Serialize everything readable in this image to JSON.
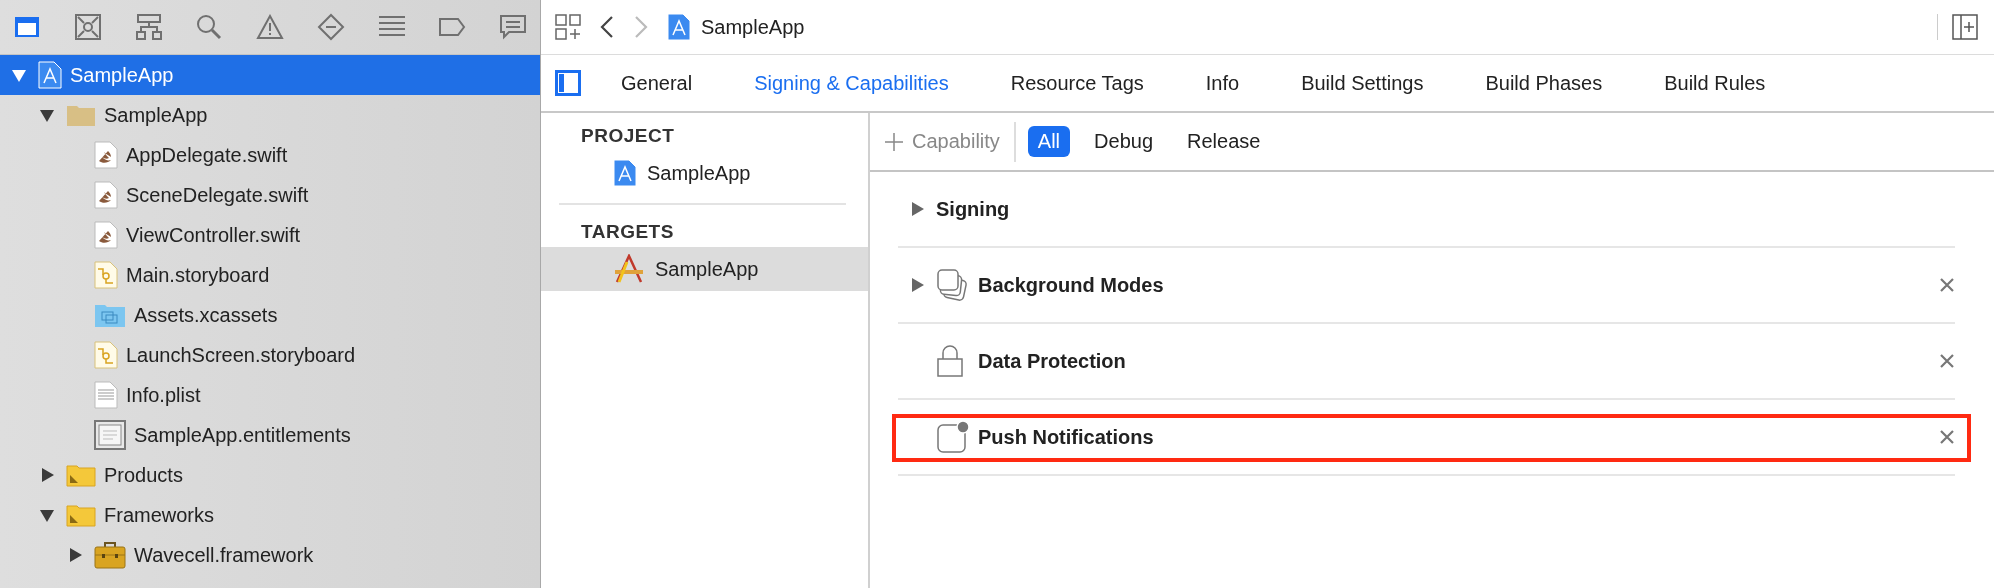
{
  "navigator_tabs": [
    {
      "kind": "folder",
      "selected": true
    },
    {
      "kind": "source-control",
      "selected": false
    },
    {
      "kind": "hierarchy",
      "selected": false
    },
    {
      "kind": "search",
      "selected": false
    },
    {
      "kind": "warning",
      "selected": false
    },
    {
      "kind": "test",
      "selected": false
    },
    {
      "kind": "list",
      "selected": false
    },
    {
      "kind": "tag",
      "selected": false
    },
    {
      "kind": "comment",
      "selected": false
    }
  ],
  "tree": [
    {
      "label": "SampleApp",
      "kind": "project",
      "expanded": true,
      "selected": true,
      "children": [
        {
          "label": "SampleApp",
          "kind": "folder",
          "expanded": true,
          "selected": false,
          "children": [
            {
              "label": "AppDelegate.swift",
              "kind": "swift",
              "selected": false
            },
            {
              "label": "SceneDelegate.swift",
              "kind": "swift",
              "selected": false
            },
            {
              "label": "ViewController.swift",
              "kind": "swift",
              "selected": false
            },
            {
              "label": "Main.storyboard",
              "kind": "storyboard",
              "selected": false
            },
            {
              "label": "Assets.xcassets",
              "kind": "assets",
              "selected": false
            },
            {
              "label": "LaunchScreen.storyboard",
              "kind": "storyboard",
              "selected": false
            },
            {
              "label": "Info.plist",
              "kind": "plist",
              "selected": false
            },
            {
              "label": "SampleApp.entitlements",
              "kind": "entitlements",
              "selected": false
            }
          ]
        },
        {
          "label": "Products",
          "kind": "group",
          "expanded": false,
          "selected": false
        },
        {
          "label": "Frameworks",
          "kind": "group",
          "expanded": true,
          "selected": false,
          "children": [
            {
              "label": "Wavecell.framework",
              "kind": "framework",
              "expanded": false,
              "selected": false
            }
          ]
        }
      ]
    }
  ],
  "jump_bar": {
    "back_enabled": true,
    "forward_enabled": false,
    "breadcrumb": "SampleApp"
  },
  "editor_tabs": [
    {
      "label": "General",
      "selected": false
    },
    {
      "label": "Signing & Capabilities",
      "selected": true
    },
    {
      "label": "Resource Tags",
      "selected": false
    },
    {
      "label": "Info",
      "selected": false
    },
    {
      "label": "Build Settings",
      "selected": false
    },
    {
      "label": "Build Phases",
      "selected": false
    },
    {
      "label": "Build Rules",
      "selected": false
    }
  ],
  "targets_panel": {
    "sections": [
      {
        "title": "PROJECT",
        "items": [
          {
            "label": "SampleApp",
            "kind": "project",
            "selected": false
          }
        ]
      },
      {
        "title": "TARGETS",
        "items": [
          {
            "label": "SampleApp",
            "kind": "target",
            "selected": true
          }
        ]
      }
    ]
  },
  "capability_bar": {
    "add_label": "Capability",
    "filters": [
      {
        "label": "All",
        "selected": true
      },
      {
        "label": "Debug",
        "selected": false
      },
      {
        "label": "Release",
        "selected": false
      }
    ]
  },
  "capabilities": [
    {
      "title": "Signing",
      "kind": "signing",
      "expanded": false,
      "removable": false,
      "highlighted": false
    },
    {
      "title": "Background Modes",
      "kind": "background-modes",
      "expanded": false,
      "removable": true,
      "highlighted": false
    },
    {
      "title": "Data Protection",
      "kind": "data-protection",
      "removable": true,
      "highlighted": false
    },
    {
      "title": "Push Notifications",
      "kind": "push-notifications",
      "removable": true,
      "highlighted": true
    }
  ]
}
